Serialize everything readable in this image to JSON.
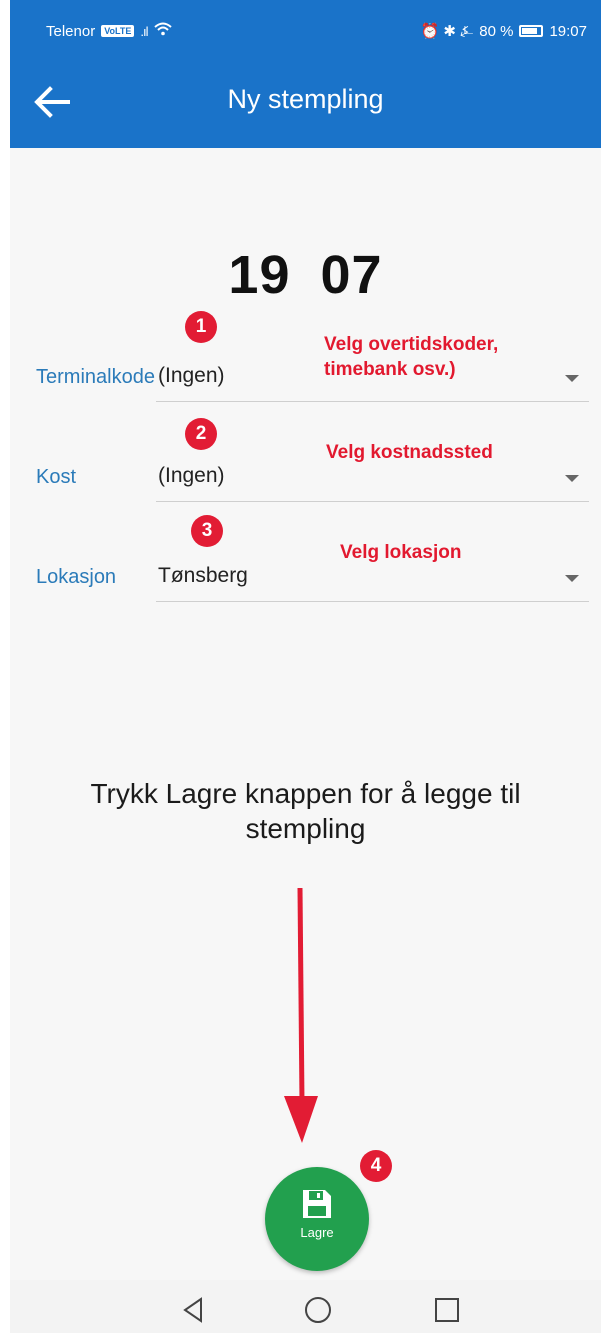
{
  "status_bar": {
    "carrier": "Telenor",
    "carrier_badge": "VoLTE",
    "indicators": "⏰ ✱ ⍼",
    "battery_percent": "80 %",
    "time": "19:07",
    "wifi_icon": "wifi-icon",
    "battery_icon": "battery-icon"
  },
  "app_bar": {
    "title": "Ny stempling",
    "back_icon": "arrow-back-icon"
  },
  "clock": {
    "hours": "19",
    "minutes": "07"
  },
  "fields": [
    {
      "label": "Terminalkode",
      "value": "(Ingen)"
    },
    {
      "label": "Kost",
      "value": "(Ingen)"
    },
    {
      "label": "Lokasjon",
      "value": "Tønsberg"
    }
  ],
  "annotations": {
    "badges": [
      "1",
      "2",
      "3",
      "4"
    ],
    "notes": {
      "note1_line1": "Velg overtidskoder,",
      "note1_line2": "timebank osv.)",
      "note2": "Velg kostnadssted",
      "note3": "Velg lokasjon"
    },
    "color": "#e21c34"
  },
  "instruction": "Trykk Lagre knappen for å legge til stempling",
  "save_button": {
    "label": "Lagre",
    "icon": "floppy-disk-icon",
    "color": "#22a04e"
  },
  "nav_bar": {
    "back_icon": "triangle-back-icon",
    "home_icon": "circle-home-icon",
    "recents_icon": "square-recents-icon"
  },
  "colors": {
    "primary": "#1a73c9",
    "label": "#2b7bb9"
  }
}
